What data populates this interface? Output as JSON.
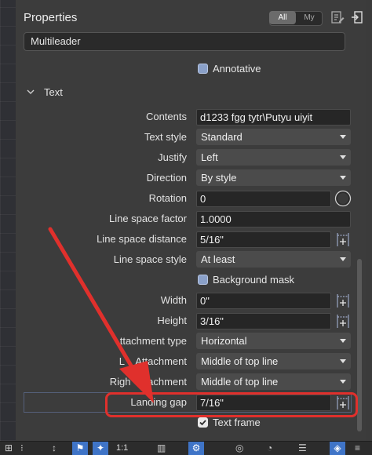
{
  "header": {
    "title": "Properties",
    "seg_all": "All",
    "seg_my": "My",
    "scope_value": "Multileader"
  },
  "annotative_label": "Annotative",
  "section": {
    "title": "Text"
  },
  "rows": {
    "contents": {
      "label": "Contents",
      "value": "d1233 fgg tytr\\Putyu uiyit"
    },
    "text_style": {
      "label": "Text style",
      "value": "Standard"
    },
    "justify": {
      "label": "Justify",
      "value": "Left"
    },
    "direction": {
      "label": "Direction",
      "value": "By style"
    },
    "rotation": {
      "label": "Rotation",
      "value": "0"
    },
    "line_space_factor": {
      "label": "Line space factor",
      "value": "1.0000"
    },
    "line_space_distance": {
      "label": "Line space distance",
      "value": "5/16\""
    },
    "line_space_style": {
      "label": "Line space style",
      "value": "At least"
    },
    "background_mask": {
      "label": "Background mask"
    },
    "width": {
      "label": "Width",
      "value": "0\""
    },
    "height": {
      "label": "Height",
      "value": "3/16\""
    },
    "attachment_type": {
      "label": "ttachment type",
      "value": "Horizontal"
    },
    "left_attachment": {
      "label": "L    Attachment",
      "value": "Middle of top line"
    },
    "right_attachment": {
      "label": "Righ    ttachment",
      "value": "Middle of top line"
    },
    "landing_gap": {
      "label": "Landing gap",
      "value": "7/16\""
    },
    "text_frame": {
      "label": "Text frame"
    }
  },
  "toolbar": {
    "scale": "1:1"
  },
  "colors": {
    "annotation_red": "#e0302c",
    "panel_bg": "#3c3c3c",
    "field_bg": "#262626"
  }
}
